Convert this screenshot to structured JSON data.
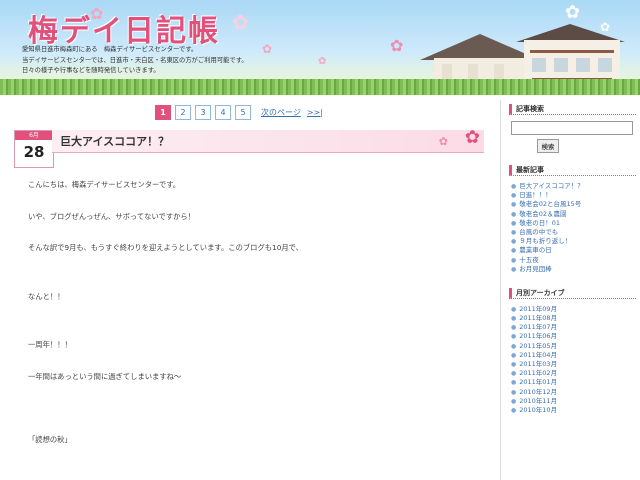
{
  "header": {
    "title": "梅デイ日記帳",
    "desc_lines": [
      "愛知県日進市梅森町にある　梅森デイサービスセンターです。",
      "当デイサービスセンターでは、日進市・天白区・名東区の方がご利用可能です。",
      "日々の様子や行事などを随時発信していきます。"
    ]
  },
  "pager": {
    "pages": [
      "1",
      "2",
      "3",
      "4",
      "5"
    ],
    "active": "1",
    "next_label": "次のページ",
    "last_label": ">>|"
  },
  "post": {
    "month": "6月",
    "day": "28",
    "title": "巨大アイスココア！？",
    "paragraphs": [
      "こんにちは、梅森デイサービスセンターです。",
      "いや、ブログぜんっぜん、サボってないですから！",
      "そんな訳で9月も、もうすぐ終わりを迎えようとしています。このブログも10月で、",
      "なんと！！",
      "一周年！！！",
      "一年間はあっという間に過ぎてしまいますね〜",
      "「読想の秋」"
    ]
  },
  "sidebar": {
    "search_heading": "記事検索",
    "search_placeholder": "",
    "search_button": "検索",
    "recent_heading": "最新記事",
    "recent": [
      "巨大アイスココア！？",
      "日進！！！",
      "敬老会02と台風15号",
      "敬老会02＆農園",
      "敬老の日！01",
      "台風の中でも",
      "９月も折り返し！",
      "農業車の日",
      "十五夜",
      "お月見団棒"
    ],
    "archive_heading": "月別アーカイブ",
    "archives": [
      "2011年09月",
      "2011年08月",
      "2011年07月",
      "2011年06月",
      "2011年05月",
      "2011年04月",
      "2011年03月",
      "2011年02月",
      "2011年01月",
      "2010年12月",
      "2010年11月",
      "2010年10月"
    ]
  },
  "colors": {
    "accent": "#e2517c",
    "link": "#3a6fb0"
  },
  "icons": [
    "flower-icon",
    "house-illustration",
    "bullet-icon"
  ]
}
